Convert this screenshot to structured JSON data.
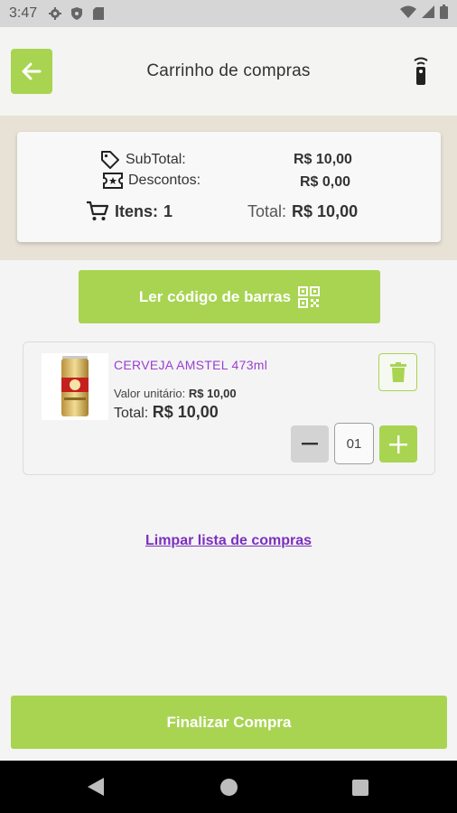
{
  "status_bar": {
    "time": "3:47",
    "left_icons": [
      "gear-icon",
      "shield-icon",
      "sd-card-icon"
    ],
    "right_icons": [
      "wifi-icon",
      "signal-icon",
      "battery-icon"
    ]
  },
  "header": {
    "title": "Carrinho de compras",
    "back_icon": "arrow-left-icon",
    "action_icon": "remote-control-icon"
  },
  "summary": {
    "subtotal_label": "SubTotal:",
    "subtotal_value": "R$ 10,00",
    "discount_label": "Descontos:",
    "discount_value": "R$ 0,00",
    "items_label": "Itens:",
    "items_count": "1",
    "total_label": "Total:",
    "total_value": "R$ 10,00"
  },
  "scan_button": {
    "label": "Ler código de barras",
    "icon": "qr-code-icon"
  },
  "cart_items": [
    {
      "name": "CERVEJA AMSTEL 473ml",
      "unit_label": "Valor unitário:",
      "unit_price": "R$ 10,00",
      "total_label": "Total:",
      "total_price": "R$ 10,00",
      "quantity": "01"
    }
  ],
  "clear_link": "Limpar lista de compras",
  "finalize_button": "Finalizar Compra",
  "colors": {
    "accent": "#a8d452",
    "link": "#7b2fbf",
    "item_name": "#9a3fd1",
    "summary_band": "#e7e1d6"
  }
}
